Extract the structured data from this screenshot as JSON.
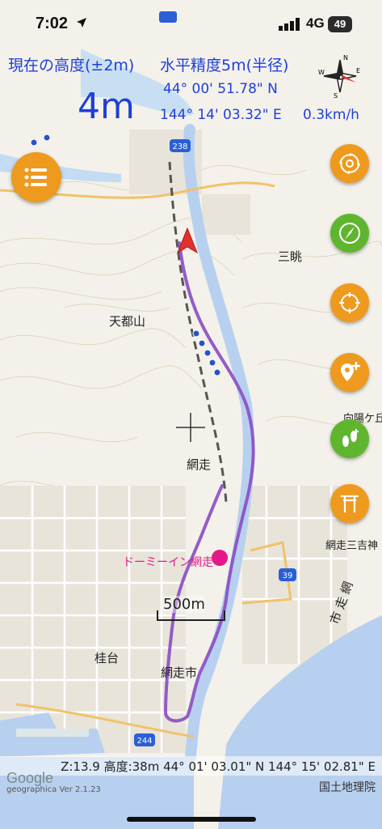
{
  "status_bar": {
    "time": "7:02",
    "network": "4G",
    "battery": "49"
  },
  "info": {
    "altitude_label": "現在の高度(±2m)",
    "accuracy_label": "水平精度5m(半径)",
    "altitude_value": "4m",
    "latitude": "44° 00' 51.78\" N",
    "longitude": "144° 14' 03.32\" E",
    "speed": "0.3km/h"
  },
  "compass": {
    "north": "N",
    "south": "S",
    "east": "E",
    "west": "W"
  },
  "map": {
    "hotel": "ドーミーイン網走",
    "places": [
      {
        "name": "天都山"
      },
      {
        "name": "三眺"
      },
      {
        "name": "網走"
      },
      {
        "name": "網走市"
      },
      {
        "name": "桂台"
      },
      {
        "name": "網走三吉神"
      },
      {
        "name": "市 走 網"
      },
      {
        "name": "向陽ケ丘"
      }
    ],
    "scale": "500m",
    "route_numbers": [
      "238",
      "244",
      "39"
    ]
  },
  "bottom": {
    "info_text": "Z:13.9 高度:38m  44° 01' 03.01\" N 144° 15' 02.81\" E",
    "google": "Google",
    "version": "geographica Ver 2.1.23",
    "credit": "国土地理院"
  },
  "colors": {
    "info_blue": "#1f3fd9",
    "fab_orange": "#ee9a1e",
    "fab_green": "#5fb62e",
    "track_purple": "#8a4bc4",
    "sea": "#b8d0ef"
  },
  "icons": [
    "location-arrow-icon",
    "signal-icon",
    "compass-icon",
    "menu-icon",
    "spiral-icon",
    "compass-needle-icon",
    "crosshair-icon",
    "add-pin-icon",
    "footprints-icon",
    "torii-icon"
  ]
}
